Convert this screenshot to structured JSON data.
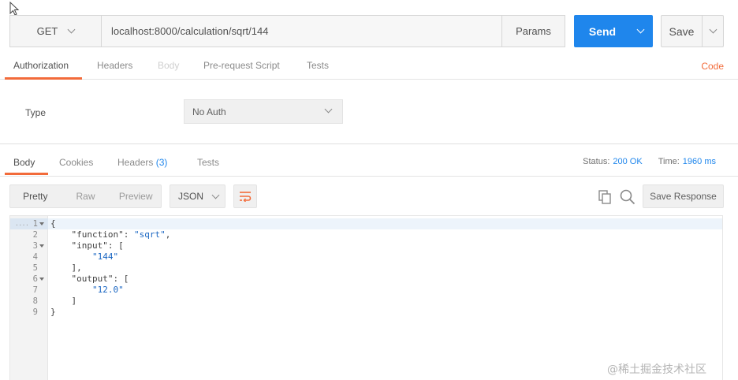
{
  "request": {
    "method": "GET",
    "url": "localhost:8000/calculation/sqrt/144",
    "params_label": "Params",
    "send_label": "Send",
    "save_label": "Save"
  },
  "request_tabs": {
    "authorization": "Authorization",
    "headers": "Headers",
    "body": "Body",
    "pre_request_script": "Pre-request Script",
    "tests": "Tests",
    "code": "Code"
  },
  "auth": {
    "type_label": "Type",
    "type_value": "No Auth"
  },
  "response_tabs": {
    "body": "Body",
    "cookies": "Cookies",
    "headers": "Headers",
    "headers_count": "(3)",
    "tests": "Tests"
  },
  "status": {
    "status_label": "Status:",
    "status_value": "200 OK",
    "time_label": "Time:",
    "time_value": "1960 ms"
  },
  "view": {
    "pretty": "Pretty",
    "raw": "Raw",
    "preview": "Preview",
    "format": "JSON",
    "save_response": "Save Response"
  },
  "code_lines": [
    {
      "num": "1",
      "foldable": true,
      "indent": "",
      "key": "",
      "val": "",
      "punct": "{"
    },
    {
      "num": "2",
      "foldable": false,
      "indent": "    ",
      "key": "\"function\": ",
      "val": "\"sqrt\"",
      "punct": ","
    },
    {
      "num": "3",
      "foldable": true,
      "indent": "    ",
      "key": "\"input\": ",
      "val": "",
      "punct": "["
    },
    {
      "num": "4",
      "foldable": false,
      "indent": "        ",
      "key": "",
      "val": "\"144\"",
      "punct": ""
    },
    {
      "num": "5",
      "foldable": false,
      "indent": "    ",
      "key": "",
      "val": "",
      "punct": "],"
    },
    {
      "num": "6",
      "foldable": true,
      "indent": "    ",
      "key": "\"output\": ",
      "val": "",
      "punct": "["
    },
    {
      "num": "7",
      "foldable": false,
      "indent": "        ",
      "key": "",
      "val": "\"12.0\"",
      "punct": ""
    },
    {
      "num": "8",
      "foldable": false,
      "indent": "    ",
      "key": "",
      "val": "",
      "punct": "]"
    },
    {
      "num": "9",
      "foldable": false,
      "indent": "",
      "key": "",
      "val": "",
      "punct": "}"
    }
  ],
  "gutter_marker": "....",
  "watermark": "@稀土掘金技术社区",
  "colors": {
    "accent_orange": "#f26b3a",
    "accent_blue": "#1f86ec",
    "string_blue": "#1a66c2"
  },
  "icons": {
    "cursor": "mouse-pointer-icon",
    "wrap": "wrap-lines-icon",
    "copy": "copy-icon",
    "search": "search-icon"
  }
}
